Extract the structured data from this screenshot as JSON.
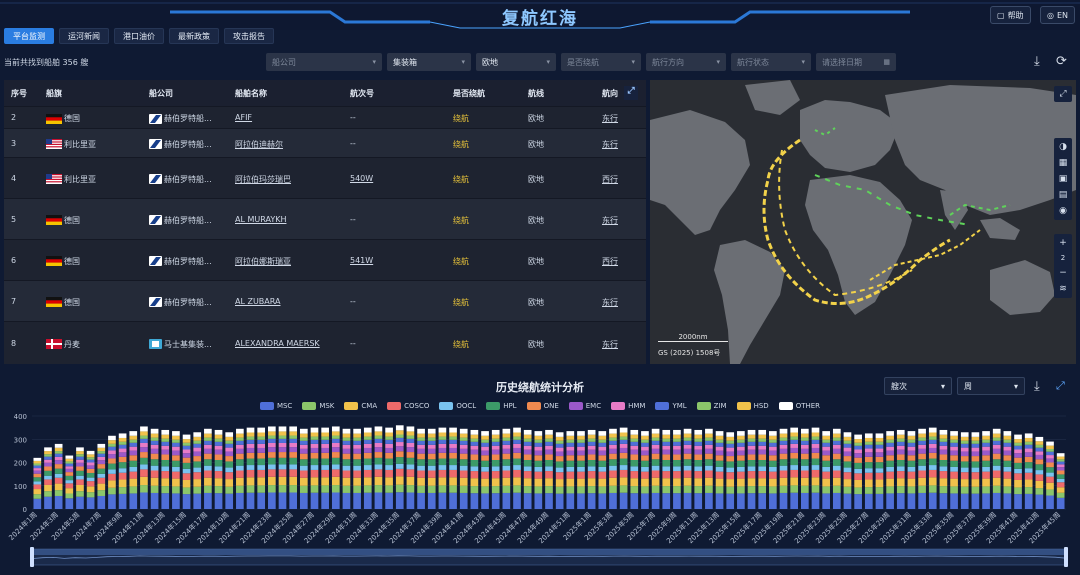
{
  "header": {
    "title": "复航红海",
    "help_label": "帮助",
    "lang_label": "EN"
  },
  "tabs": [
    {
      "label": "平台监测",
      "active": true
    },
    {
      "label": "运河新闻",
      "active": false
    },
    {
      "label": "港口油价",
      "active": false
    },
    {
      "label": "最新政策",
      "active": false
    },
    {
      "label": "攻击报告",
      "active": false
    }
  ],
  "result_count_text": "当前共找到船舶 356 艘",
  "filters": [
    {
      "placeholder": "船公司",
      "value": "",
      "kind": "select"
    },
    {
      "placeholder": "集装箱",
      "value": "集装箱",
      "kind": "select"
    },
    {
      "placeholder": "欧地",
      "value": "欧地",
      "kind": "select"
    },
    {
      "placeholder": "是否绕航",
      "value": "",
      "kind": "select"
    },
    {
      "placeholder": "航行方向",
      "value": "",
      "kind": "select"
    },
    {
      "placeholder": "航行状态",
      "value": "",
      "kind": "select"
    },
    {
      "placeholder": "请选择日期",
      "value": "",
      "kind": "date"
    }
  ],
  "table": {
    "columns": [
      "序号",
      "船旗",
      "船公司",
      "船舶名称",
      "航次号",
      "是否绕航",
      "航线",
      "航向"
    ],
    "rows": [
      {
        "idx": "2",
        "flag": "德国",
        "flag_code": "de",
        "company": "赫伯罗特船...",
        "company_logo": "hapag",
        "ship": "AFIF",
        "voyage": "--",
        "detour": "绕航",
        "route": "欧地",
        "dir": "东行"
      },
      {
        "idx": "3",
        "flag": "利比里亚",
        "flag_code": "lr",
        "company": "赫伯罗特船...",
        "company_logo": "hapag",
        "ship": "阿拉伯迪赫尔",
        "voyage": "--",
        "detour": "绕航",
        "route": "欧地",
        "dir": "东行"
      },
      {
        "idx": "4",
        "flag": "利比里亚",
        "flag_code": "lr",
        "company": "赫伯罗特船...",
        "company_logo": "hapag",
        "ship": "阿拉伯玛莎瑞巴",
        "voyage": "540W",
        "detour": "绕航",
        "route": "欧地",
        "dir": "西行"
      },
      {
        "idx": "5",
        "flag": "德国",
        "flag_code": "de",
        "company": "赫伯罗特船...",
        "company_logo": "hapag",
        "ship": "AL MURAYKH",
        "voyage": "--",
        "detour": "绕航",
        "route": "欧地",
        "dir": "东行"
      },
      {
        "idx": "6",
        "flag": "德国",
        "flag_code": "de",
        "company": "赫伯罗特船...",
        "company_logo": "hapag",
        "ship": "阿拉伯娜斯瑞亚",
        "voyage": "541W",
        "detour": "绕航",
        "route": "欧地",
        "dir": "西行"
      },
      {
        "idx": "7",
        "flag": "德国",
        "flag_code": "de",
        "company": "赫伯罗特船...",
        "company_logo": "hapag",
        "ship": "AL ZUBARA",
        "voyage": "--",
        "detour": "绕航",
        "route": "欧地",
        "dir": "东行"
      },
      {
        "idx": "8",
        "flag": "丹麦",
        "flag_code": "dk",
        "company": "马士基集装...",
        "company_logo": "maersk",
        "ship": "ALEXANDRA MAERSK",
        "voyage": "--",
        "detour": "绕航",
        "route": "欧地",
        "dir": "东行"
      }
    ]
  },
  "map": {
    "scale_label": "2000nm",
    "attribution": "GS (2025) 1508号",
    "zoom_level": "2",
    "colors": {
      "detour": "#f2d24a",
      "normal": "#5fd35a",
      "land": "#6b6e74",
      "sea": "#2a2d33"
    }
  },
  "chart_header": {
    "title": "历史绕航统计分析",
    "metric_select": "艘次",
    "period_select": "周"
  },
  "chart_data": {
    "type": "bar",
    "stacked": true,
    "title": "历史绕航统计分析",
    "ylim": [
      0,
      400
    ],
    "yticks": [
      "0",
      "100",
      "200",
      "300",
      "400"
    ],
    "x_tick_labels": [
      "2024年1周",
      "2024年3周",
      "2024年5周",
      "2024年7周",
      "2024年9周",
      "2024年11周",
      "2024年13周",
      "2024年15周",
      "2024年17周",
      "2024年19周",
      "2024年21周",
      "2024年23周",
      "2024年25周",
      "2024年27周",
      "2024年29周",
      "2024年31周",
      "2024年33周",
      "2024年35周",
      "2024年37周",
      "2024年39周",
      "2024年41周",
      "2024年43周",
      "2024年45周",
      "2024年47周",
      "2024年49周",
      "2024年51周",
      "2025年1周",
      "2025年3周",
      "2025年5周",
      "2025年7周",
      "2025年9周",
      "2025年11周",
      "2025年13周",
      "2025年15周",
      "2025年17周",
      "2025年19周",
      "2025年21周",
      "2025年23周",
      "2025年25周",
      "2025年27周",
      "2025年29周",
      "2025年31周",
      "2025年33周",
      "2025年35周",
      "2025年37周",
      "2025年39周",
      "2025年41周",
      "2025年43周",
      "2025年45周"
    ],
    "totals": [
      220,
      265,
      280,
      230,
      265,
      250,
      280,
      315,
      325,
      335,
      355,
      345,
      340,
      335,
      320,
      330,
      345,
      340,
      330,
      345,
      350,
      350,
      355,
      355,
      355,
      345,
      350,
      350,
      355,
      345,
      345,
      350,
      355,
      350,
      360,
      355,
      345,
      345,
      350,
      350,
      345,
      340,
      335,
      340,
      345,
      350,
      340,
      335,
      340,
      330,
      335,
      335,
      340,
      335,
      345,
      350,
      340,
      335,
      345,
      340,
      340,
      345,
      340,
      345,
      335,
      330,
      335,
      340,
      340,
      335,
      345,
      350,
      345,
      350,
      335,
      345,
      330,
      320,
      325,
      325,
      335,
      340,
      335,
      345,
      350,
      340,
      335,
      330,
      330,
      335,
      345,
      335,
      320,
      325,
      310,
      290,
      240
    ],
    "series": [
      {
        "name": "MSC",
        "color": "#4f6fd8",
        "share": 0.2
      },
      {
        "name": "MSK",
        "color": "#8bc66a",
        "share": 0.09
      },
      {
        "name": "CMA",
        "color": "#f1c24b",
        "share": 0.1
      },
      {
        "name": "COSCO",
        "color": "#ee6a6a",
        "share": 0.09
      },
      {
        "name": "OOCL",
        "color": "#79c3ef",
        "share": 0.06
      },
      {
        "name": "HPL",
        "color": "#3c9a68",
        "share": 0.08
      },
      {
        "name": "ONE",
        "color": "#f08a4f",
        "share": 0.07
      },
      {
        "name": "EMC",
        "color": "#9b59c9",
        "share": 0.06
      },
      {
        "name": "HMM",
        "color": "#e87bc6",
        "share": 0.05
      },
      {
        "name": "YML",
        "color": "#4f6fd8",
        "share": 0.05
      },
      {
        "name": "ZIM",
        "color": "#8bc66a",
        "share": 0.04
      },
      {
        "name": "HSD",
        "color": "#f1c24b",
        "share": 0.05
      },
      {
        "name": "OTHER",
        "color": "#ffffff",
        "share": 0.06
      }
    ]
  }
}
